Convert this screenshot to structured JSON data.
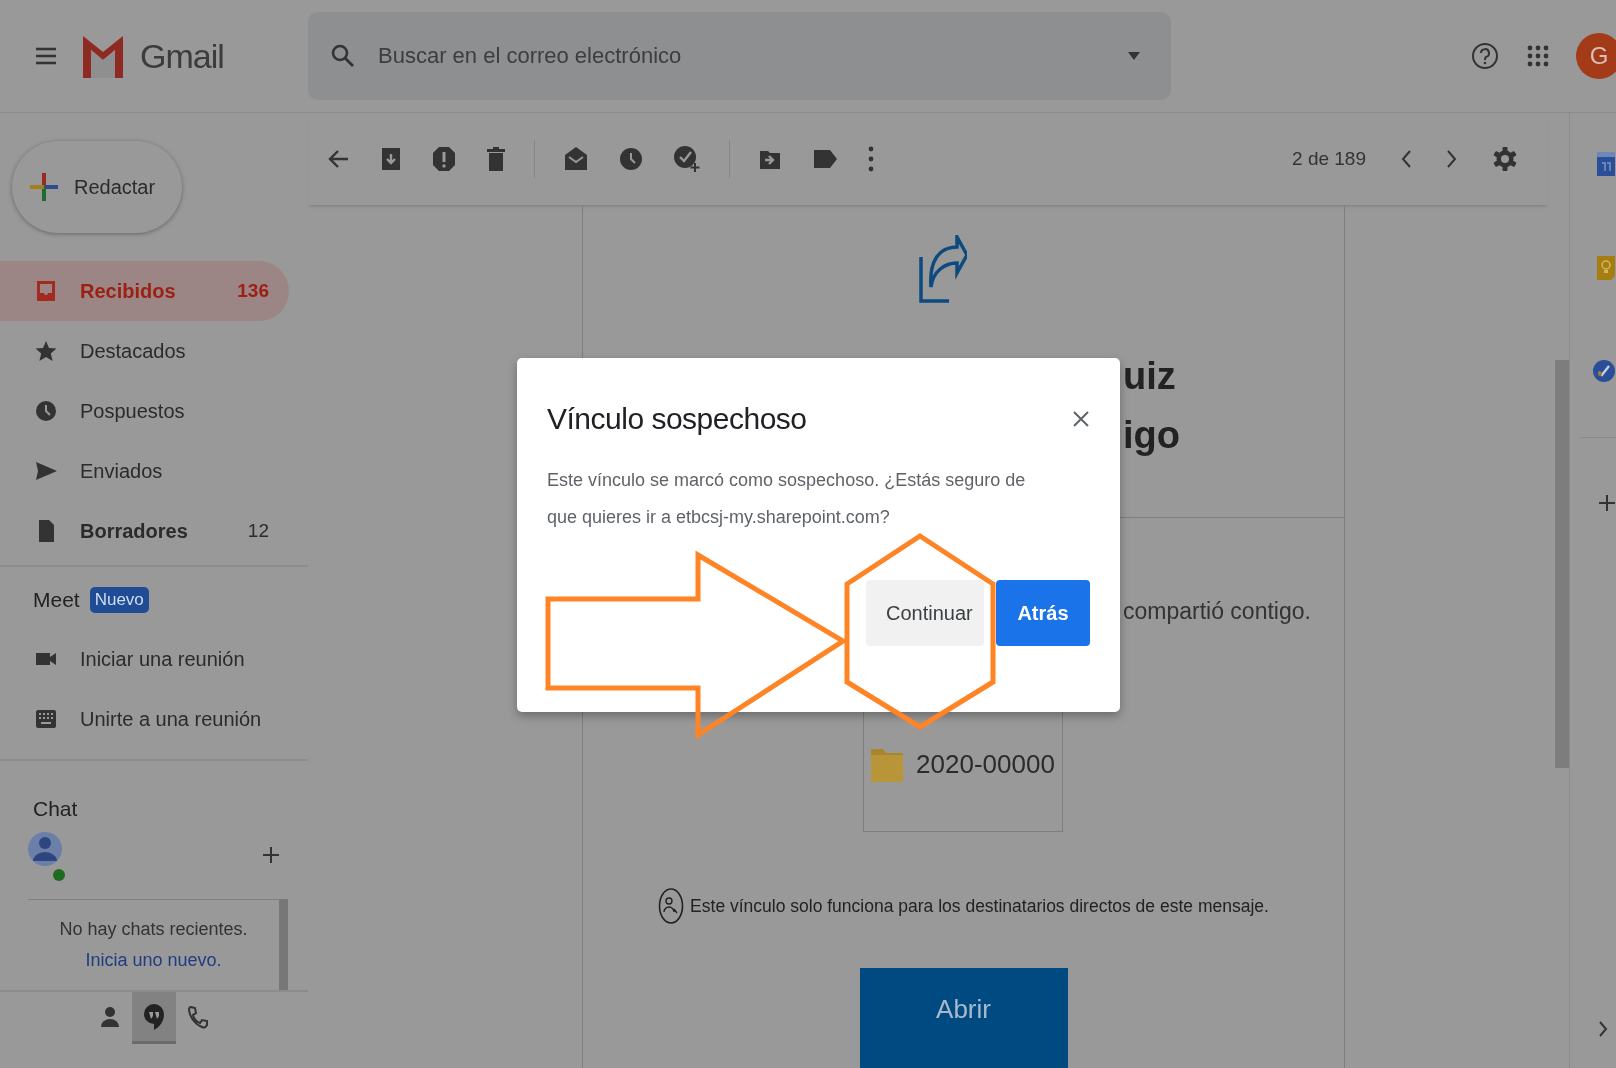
{
  "header": {
    "app_name": "Gmail",
    "search": {
      "placeholder": "Buscar en el correo electrónico"
    },
    "avatar_letter": "G"
  },
  "compose": {
    "label": "Redactar"
  },
  "nav": [
    {
      "kind": "inbox",
      "label": "Recibidos",
      "count": "136",
      "selected": true,
      "unread": true
    },
    {
      "kind": "starred",
      "label": "Destacados",
      "selected": false,
      "unread": false
    },
    {
      "kind": "snoozed",
      "label": "Pospuestos",
      "selected": false,
      "unread": false
    },
    {
      "kind": "sent",
      "label": "Enviados",
      "selected": false,
      "unread": false
    },
    {
      "kind": "drafts",
      "label": "Borradores",
      "count": "12",
      "selected": false,
      "unread": true
    }
  ],
  "meet": {
    "title": "Meet",
    "badge": "Nuevo",
    "items": [
      {
        "kind": "video",
        "label": "Iniciar una reunión"
      },
      {
        "kind": "keyboard",
        "label": "Unirte a una reunión"
      }
    ]
  },
  "chat": {
    "title": "Chat",
    "empty_text": "No hay chats recientes.",
    "start_link": "Inicia uno nuevo.",
    "tabs": [
      {
        "kind": "contacts",
        "selected": false
      },
      {
        "kind": "hangouts",
        "selected": true
      },
      {
        "kind": "phone",
        "selected": false
      }
    ]
  },
  "toolbar": {
    "pagination": "2 de 189"
  },
  "email": {
    "heading_fragments": [
      "uiz",
      "igo"
    ],
    "shared_text_fragment": "compartió contigo.",
    "file_name": "2020-00000",
    "notice": "Este vínculo solo funciona para los destinatarios directos de este mensaje.",
    "open_button": "Abrir"
  },
  "dialog": {
    "title": "Vínculo sospechoso",
    "message": "Este vínculo se marcó como sospechoso. ¿Estás seguro de que quieres ir a etbcsj-my.sharepoint.com?",
    "buttons": [
      {
        "kind": "secondary",
        "label": "Continuar"
      },
      {
        "kind": "primary",
        "label": "Atrás"
      }
    ]
  },
  "annotations": {
    "arrow": true,
    "hexagon_outline": true
  }
}
